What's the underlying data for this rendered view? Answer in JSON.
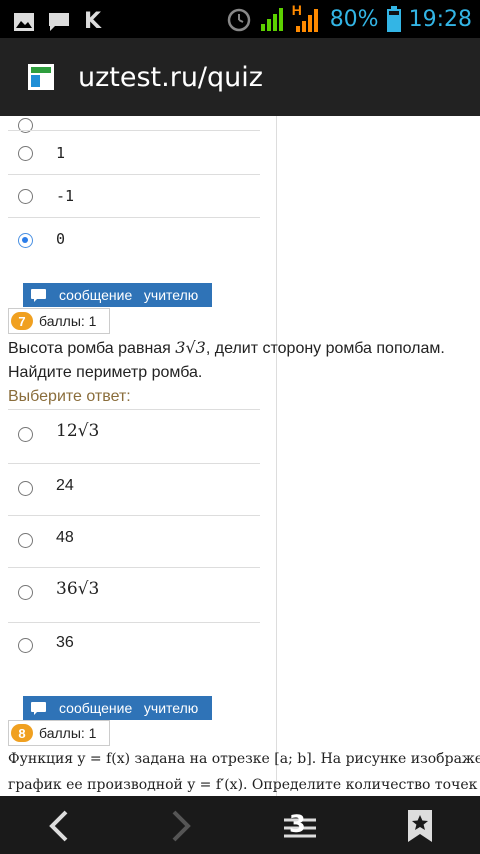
{
  "status_bar": {
    "k_letter": "K",
    "network_badge": "H",
    "battery": "80%",
    "time": "19:28"
  },
  "url_bar": {
    "url": "uztest.ru/quiz"
  },
  "question6_options": [
    {
      "label": "1",
      "checked": false
    },
    {
      "label": "-1",
      "checked": false
    },
    {
      "label": "0",
      "checked": true
    }
  ],
  "message_button": {
    "label": "сообщение   учителю"
  },
  "question7": {
    "number": "7",
    "score": "баллы: 1",
    "text_part1": "Высота ромба равная ",
    "text_math": "3√3",
    "text_part2": ", делит сторону ромба пополам.",
    "text_line2": "Найдите периметр ромба.",
    "choose_label": "Выберите ответ:",
    "options": [
      {
        "label": "12√3",
        "math": true
      },
      {
        "label": "24",
        "math": false
      },
      {
        "label": "48",
        "math": false
      },
      {
        "label": "36√3",
        "math": true
      },
      {
        "label": "36",
        "math": false
      }
    ]
  },
  "question8": {
    "number": "8",
    "score": "баллы: 1",
    "line1": "Функция y = f(x) задана на отрезке [a; b]. На рисунке изображе",
    "line2": "график ее производной y = f′(x). Определите количество точек"
  },
  "nav_bar": {
    "tabs_count": "3"
  }
}
